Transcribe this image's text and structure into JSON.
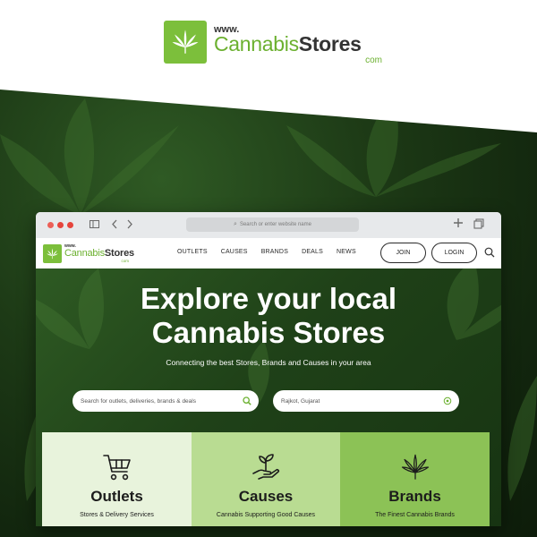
{
  "brand": {
    "www": "www.",
    "name_light": "Cannabis",
    "name_bold": "Stores",
    "tld": "com",
    "accent_color": "#7cbf3b"
  },
  "browser": {
    "address_placeholder": "Search or enter website name",
    "new_tab_icon": "plus-icon",
    "tabs_icon": "tabs-icon"
  },
  "site": {
    "logo": {
      "www": "www.",
      "name_light": "Cannabis",
      "name_bold": "Stores",
      "tld": "com"
    },
    "nav": [
      "OUTLETS",
      "CAUSES",
      "BRANDS",
      "DEALS",
      "NEWS"
    ],
    "join_label": "JOIN",
    "login_label": "LOGIN",
    "hero": {
      "title_line1": "Explore your local",
      "title_line2": "Cannabis Stores",
      "subtitle": "Connecting the best Stores, Brands and Causes in your area"
    },
    "search": {
      "placeholder": "Search for outlets, deliveries, brands & deals",
      "location_value": "Rajkot, Gujarat"
    },
    "tiles": [
      {
        "title": "Outlets",
        "subtitle": "Stores & Delivery Services",
        "icon": "cart-icon"
      },
      {
        "title": "Causes",
        "subtitle": "Cannabis Supporting Good Causes",
        "icon": "sprout-hand-icon"
      },
      {
        "title": "Brands",
        "subtitle": "The Finest Cannabis Brands",
        "icon": "cannabis-leaf-icon"
      }
    ]
  }
}
